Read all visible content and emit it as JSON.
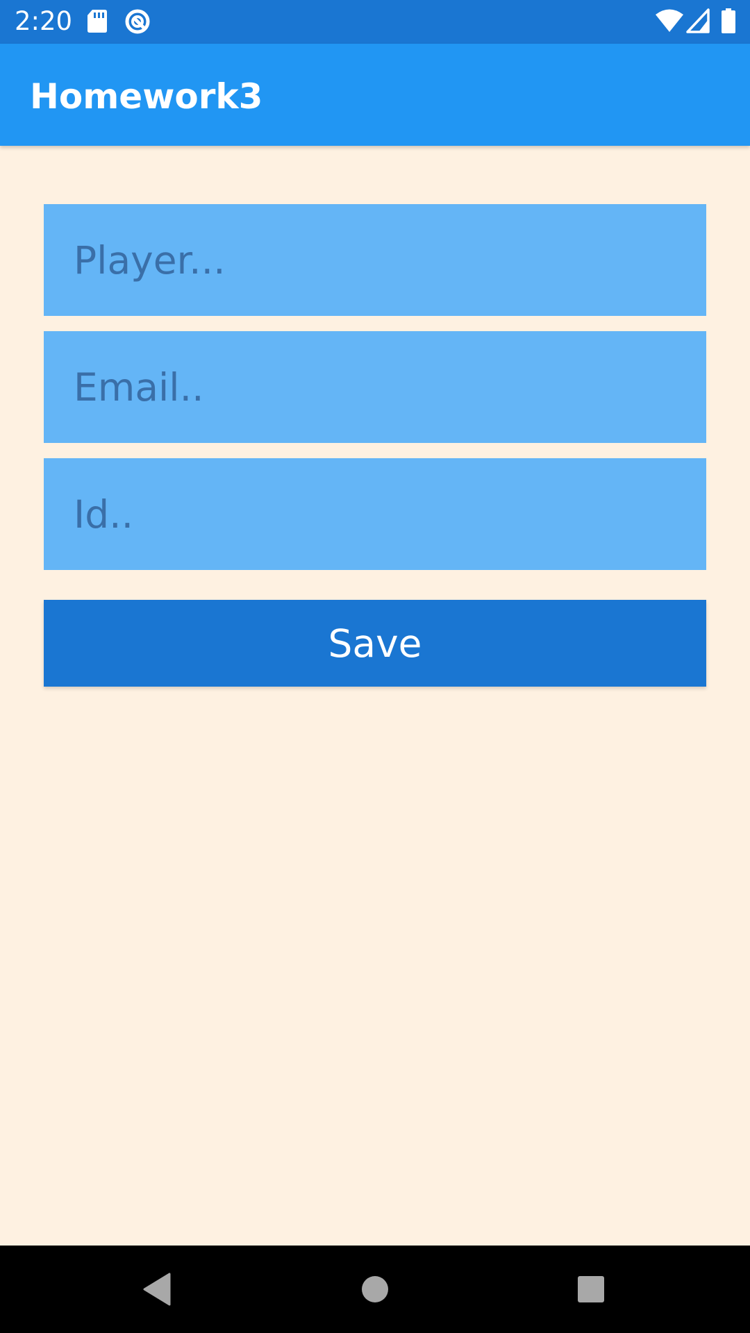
{
  "status_bar": {
    "time": "2:20",
    "icons": [
      "sd-card-icon",
      "sync-icon",
      "wifi-icon",
      "signal-icon",
      "battery-icon"
    ]
  },
  "app_bar": {
    "title": "Homework3",
    "color": "#2196F3"
  },
  "form": {
    "player": {
      "placeholder": "Player...",
      "value": ""
    },
    "email": {
      "placeholder": "Email..",
      "value": ""
    },
    "id": {
      "placeholder": "Id..",
      "value": ""
    },
    "field_color": "#64B5F6",
    "save_label": "Save",
    "save_color": "#1A76D2"
  },
  "nav_bar": {
    "buttons": [
      "back-icon",
      "home-icon",
      "recents-icon"
    ]
  },
  "colors": {
    "background": "#FEF1E1",
    "status_bar": "#1A76D2"
  }
}
